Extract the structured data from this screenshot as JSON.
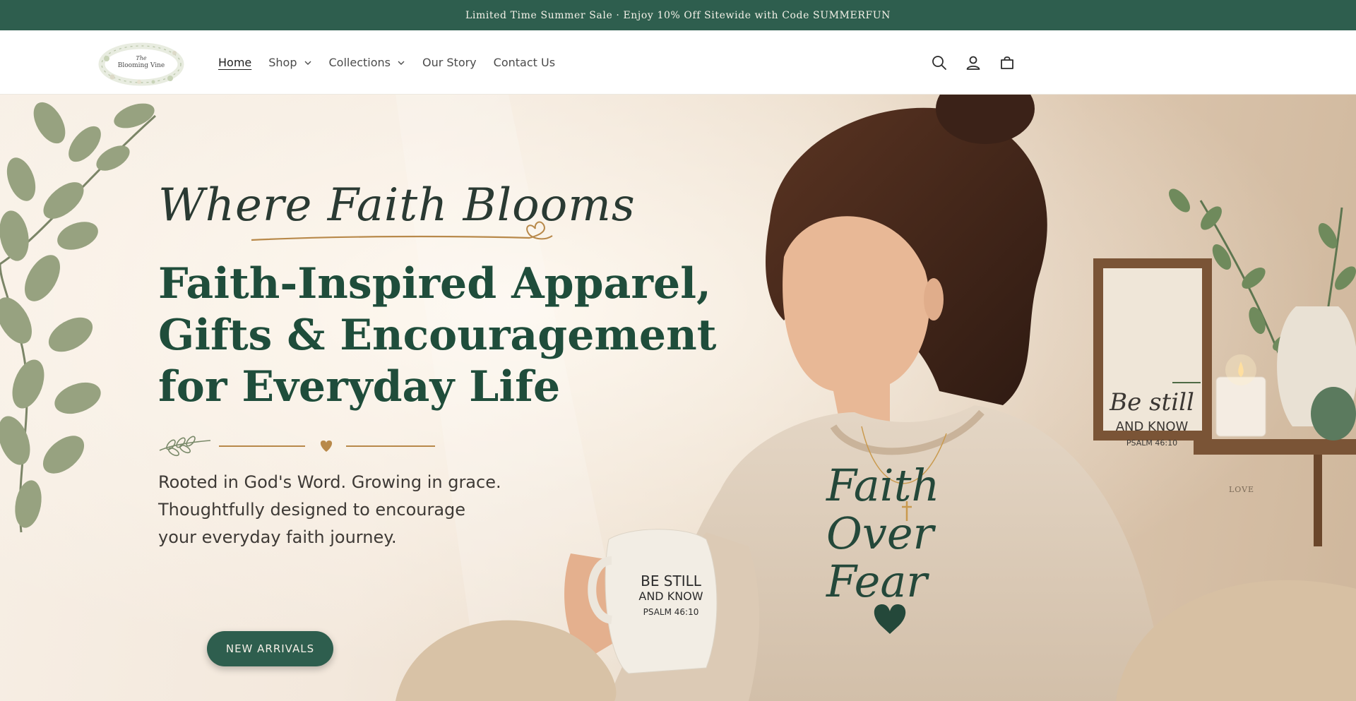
{
  "announcement": {
    "text": "Limited Time Summer Sale · Enjoy 10% Off Sitewide with Code SUMMERFUN"
  },
  "header": {
    "logo": {
      "line1": "The",
      "line2": "Blooming Vine"
    },
    "nav": [
      {
        "label": "Home",
        "active": true,
        "has_dropdown": false
      },
      {
        "label": "Shop",
        "active": false,
        "has_dropdown": true
      },
      {
        "label": "Collections",
        "active": false,
        "has_dropdown": true
      },
      {
        "label": "Our Story",
        "active": false,
        "has_dropdown": false
      },
      {
        "label": "Contact Us",
        "active": false,
        "has_dropdown": false
      }
    ],
    "icons": [
      "search-icon",
      "account-icon",
      "cart-icon"
    ]
  },
  "hero": {
    "script_title": "Where Faith Blooms",
    "headline": [
      "Faith-Inspired Apparel,",
      "Gifts & Encouragement",
      "for Everyday Life"
    ],
    "subtext": [
      "Rooted in God's Word. Growing in grace.",
      "Thoughtfully designed to encourage",
      "your everyday faith journey."
    ],
    "cta_label": "NEW ARRIVALS",
    "sweatshirt_text": [
      "Faith",
      "Over",
      "Fear"
    ],
    "mug_text": [
      "BE STILL",
      "AND KNOW",
      "PSALM 46:10"
    ],
    "frame_text": [
      "Be still",
      "AND KNOW",
      "PSALM 46:10"
    ],
    "candle_text": "LOVE"
  },
  "colors": {
    "brand_green": "#2e5e4e",
    "headline_green": "#1f4d3b",
    "accent_gold": "#b8894a",
    "hero_background": "#f3e8dc"
  }
}
